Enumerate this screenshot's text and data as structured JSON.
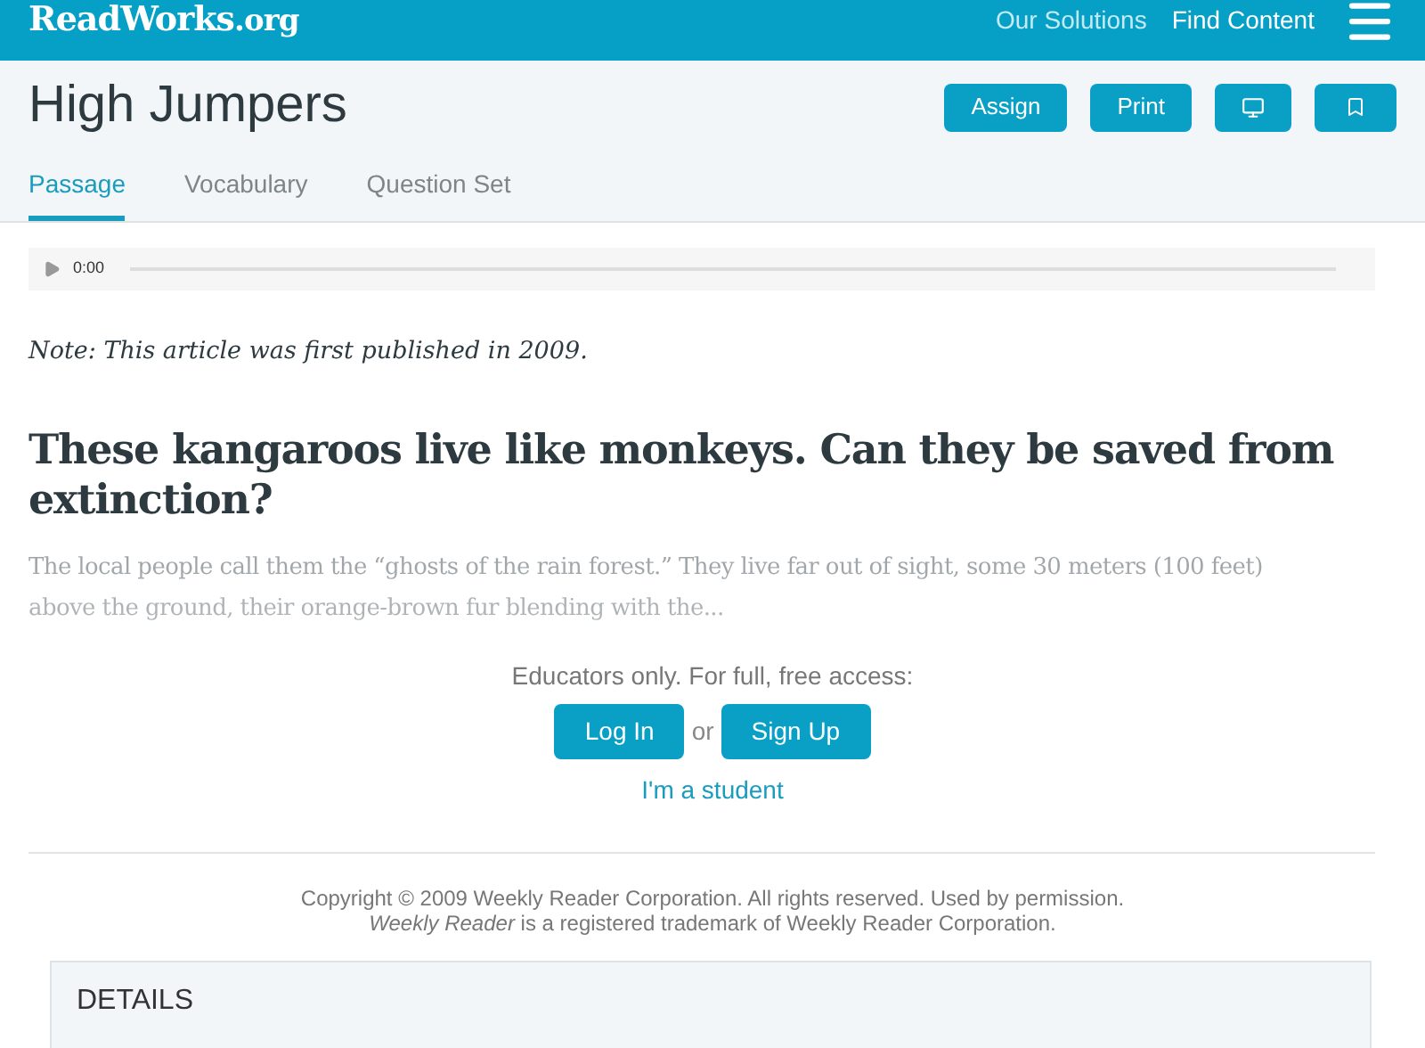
{
  "header": {
    "logo": "ReadWorks",
    "logo_suffix": ".org",
    "nav": [
      "Our Solutions",
      "Find Content"
    ]
  },
  "title": "High Jumpers",
  "actions": [
    {
      "kind": "text",
      "label": "Assign"
    },
    {
      "kind": "text",
      "label": "Print"
    },
    {
      "kind": "monitor"
    },
    {
      "kind": "bookmark"
    }
  ],
  "tabs": [
    {
      "label": "Passage",
      "selected": true
    },
    {
      "label": "Vocabulary",
      "selected": false
    },
    {
      "label": "Question Set",
      "selected": false
    }
  ],
  "audio": {
    "time": "0:00"
  },
  "note": "Note: This article was first published in 2009.",
  "headline": "These kangaroos live like monkeys. Can they be saved from extinction?",
  "excerpt": "The local people call them the “ghosts of the rain forest.” They live far out of sight, some 30 meters (100 feet) above the ground, their orange-brown fur blending with the...",
  "access": {
    "prompt": "Educators only. For full, free access:",
    "login": "Log In",
    "or": "or",
    "signup": "Sign Up",
    "student": "I'm a student"
  },
  "copyright": [
    "Copyright © 2009 Weekly Reader Corporation. All rights reserved. Used by permission.",
    "*Weekly Reader* is a registered trademark of Weekly Reader Corporation."
  ],
  "details": {
    "heading": "DETAILS"
  }
}
